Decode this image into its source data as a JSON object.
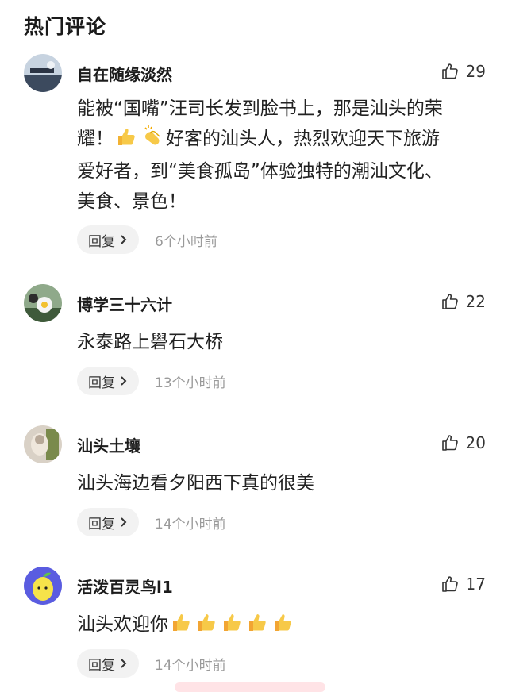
{
  "section_title": "热门评论",
  "comments": [
    {
      "username": "自在随缘淡然",
      "likes": "29",
      "text_lines": [
        "能被“国嘴”汪司长发到脸书上，那是汕头的荣",
        "耀！",
        "好客的汕头人，热烈欢迎天下旅游",
        "爱好者，到“美食孤岛”体验独特的潮汕文化、",
        "美食、景色！"
      ],
      "reply_label": "回复",
      "time": "6个小时前"
    },
    {
      "username": "博学三十六计",
      "likes": "22",
      "text": "永泰路上礐石大桥",
      "reply_label": "回复",
      "time": "13个小时前"
    },
    {
      "username": "汕头土壤",
      "likes": "20",
      "text": "汕头海边看夕阳西下真的很美",
      "reply_label": "回复",
      "time": "14个小时前"
    },
    {
      "username": "活泼百灵鸟l1",
      "likes": "17",
      "text": "汕头欢迎你",
      "reply_label": "回复",
      "time": "14个小时前"
    }
  ],
  "icons": {
    "like": "thumbs-up-outline-icon",
    "reply_arrow": "chevron-right-icon",
    "emoji_thumbs": "thumbs-up-emoji",
    "emoji_clap": "clapping-hands-emoji"
  },
  "colors": {
    "reply_bg": "#f2f2f2",
    "time_text": "#9a9a9a",
    "emoji_yellow": "#f7c948"
  }
}
